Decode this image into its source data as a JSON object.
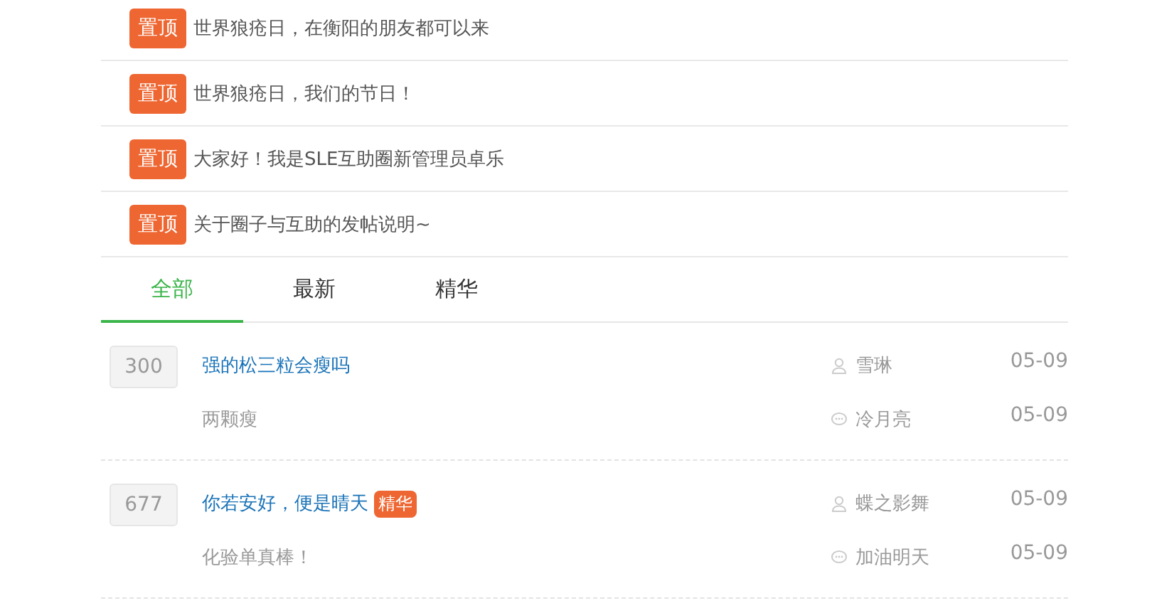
{
  "pinned": [
    {
      "badge": "置顶",
      "title": "世界狼疮日，在衡阳的朋友都可以来"
    },
    {
      "badge": "置顶",
      "title": "世界狼疮日，我们的节日！"
    },
    {
      "badge": "置顶",
      "title": "大家好！我是SLE互助圈新管理员卓乐"
    },
    {
      "badge": "置顶",
      "title": "关于圈子与互助的发帖说明~"
    }
  ],
  "tabs": [
    {
      "label": "全部",
      "selected": true
    },
    {
      "label": "最新",
      "selected": false
    },
    {
      "label": "精华",
      "selected": false
    }
  ],
  "posts": [
    {
      "count": "300",
      "title": "强的松三粒会瘦吗",
      "author": "雪琳",
      "date": "05-09",
      "reply": "两颗瘦",
      "replier": "冷月亮",
      "reply_date": "05-09"
    },
    {
      "count": "677",
      "title": "你若安好，便是晴天",
      "tag": "精华",
      "author": "蝶之影舞",
      "date": "05-09",
      "reply": "化验单真棒！",
      "replier": "加油明天",
      "reply_date": "05-09"
    }
  ]
}
